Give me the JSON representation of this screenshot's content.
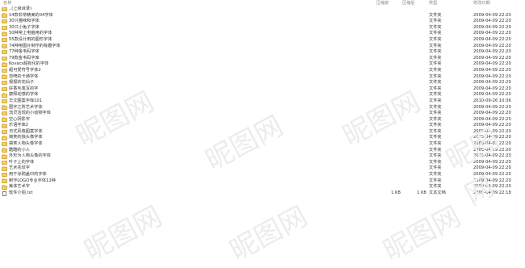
{
  "columns": {
    "name": "名称",
    "size": "压缩前",
    "csize": "压缩后",
    "type": "类型",
    "date": "修改日期"
  },
  "rows": [
    {
      "name": "..(上级目录)",
      "icon": "folder",
      "size": "",
      "csize": "",
      "type": "",
      "date": ""
    },
    {
      "name": "14款非常精美的04字体",
      "icon": "folder",
      "size": "",
      "csize": "",
      "type": "文件夹",
      "date": "2009-04-09 22:20"
    },
    {
      "name": "30只猫咪和字体",
      "icon": "folder",
      "size": "",
      "csize": "",
      "type": "文件夹",
      "date": "2009-04-09 22:20"
    },
    {
      "name": "30只小兔子字体",
      "icon": "folder",
      "size": "",
      "csize": "",
      "type": "文件夹",
      "date": "2009-04-09 22:20"
    },
    {
      "name": "50种常上电脑用的字体",
      "icon": "folder",
      "size": "",
      "csize": "",
      "type": "文件夹",
      "date": "2009-04-09 22:20"
    },
    {
      "name": "55款设计用的图形字体",
      "icon": "folder",
      "size": "",
      "csize": "",
      "type": "文件夹",
      "date": "2009-04-09 22:20"
    },
    {
      "name": "74种用图片制作的有趣字体",
      "icon": "folder",
      "size": "",
      "csize": "",
      "type": "文件夹",
      "date": "2009-04-09 22:20"
    },
    {
      "name": "77种金韦码字体",
      "icon": "folder",
      "size": "",
      "csize": "",
      "type": "文件夹",
      "date": "2009-04-09 22:20"
    },
    {
      "name": "79款金韦码字库",
      "icon": "folder",
      "size": "",
      "csize": "",
      "type": "文件夹",
      "date": "2009-04-09 22:20"
    },
    {
      "name": "Kovacs超有化的字体",
      "icon": "folder",
      "size": "",
      "csize": "",
      "type": "文件夹",
      "date": "2009-04-09 22:20"
    },
    {
      "name": "超可爱符号字体2",
      "icon": "folder",
      "size": "",
      "csize": "",
      "type": "文件夹",
      "date": "2009-04-09 22:20"
    },
    {
      "name": "范啤的卡通字体",
      "icon": "folder",
      "size": "",
      "csize": "",
      "type": "文件夹",
      "date": "2009-04-09 22:20"
    },
    {
      "name": "报报的花仙子",
      "icon": "folder",
      "size": "",
      "csize": "",
      "type": "文件夹",
      "date": "2009-04-09 22:20"
    },
    {
      "name": "好香毛笔写的字",
      "icon": "folder",
      "size": "",
      "csize": "",
      "type": "文件夹",
      "date": "2009-04-09 22:20"
    },
    {
      "name": "康熙动感的字体",
      "icon": "folder",
      "size": "",
      "csize": "",
      "type": "文件夹",
      "date": "2009-04-09 22:20"
    },
    {
      "name": "华文图案字库101",
      "icon": "folder",
      "size": "",
      "csize": "",
      "type": "文件夹",
      "date": "2010-09-26 10:36"
    },
    {
      "name": "圈字之所艺术字体",
      "icon": "folder",
      "size": "",
      "csize": "",
      "type": "文件夹",
      "date": "2009-04-09 22:20"
    },
    {
      "name": "流灵活现的小动物字体",
      "icon": "folder",
      "size": "",
      "csize": "",
      "type": "文件夹",
      "date": "2009-04-09 22:20"
    },
    {
      "name": "空心阴影字",
      "icon": "folder",
      "size": "",
      "csize": "",
      "type": "文件夹",
      "date": "2009-04-09 22:20"
    },
    {
      "name": "乐语字库2",
      "icon": "folder",
      "size": "",
      "csize": "",
      "type": "文件夹",
      "date": "2009-04-09 22:20"
    },
    {
      "name": "日式风格图案字体",
      "icon": "folder",
      "size": "",
      "csize": "",
      "type": "文件夹",
      "date": "2009-04-09 22:20"
    },
    {
      "name": "搞笑的独头像字体",
      "icon": "folder",
      "size": "",
      "csize": "",
      "type": "文件夹",
      "date": "2009-04-09 22:20"
    },
    {
      "name": "搞笑人物头像字体",
      "icon": "folder",
      "size": "",
      "csize": "",
      "type": "文件夹",
      "date": "2009-04-09 22:20"
    },
    {
      "name": "酷酷的小人",
      "icon": "folder",
      "size": "",
      "csize": "",
      "type": "文件夹",
      "date": "2009-04-09 22:20"
    },
    {
      "name": "外形为人物头像的字体",
      "icon": "folder",
      "size": "",
      "csize": "",
      "type": "文件夹",
      "date": "2009-04-09 22:20"
    },
    {
      "name": "叶子上的字体",
      "icon": "folder",
      "size": "",
      "csize": "",
      "type": "文件夹",
      "date": "2009-04-09 22:20"
    },
    {
      "name": "艺术花纹字",
      "icon": "folder",
      "size": "",
      "csize": "",
      "type": "文件夹",
      "date": "2009-04-09 22:20"
    },
    {
      "name": "用于涂鸦盖印的字体",
      "icon": "folder",
      "size": "",
      "csize": "",
      "type": "文件夹",
      "date": "2009-04-09 22:20"
    },
    {
      "name": "制作LOGO专业字体12种",
      "icon": "folder",
      "size": "",
      "csize": "",
      "type": "文件夹",
      "date": "2009-04-09 22:20"
    },
    {
      "name": "美体艺术字",
      "icon": "folder",
      "size": "",
      "csize": "",
      "type": "文件夹",
      "date": "2009-04-09 22:20"
    },
    {
      "name": "软件介绍.txt",
      "icon": "file",
      "size": "1 KB",
      "csize": "1 KB",
      "type": "文本文档",
      "date": "2009-04-09 22:18"
    }
  ],
  "watermark": "昵图网"
}
